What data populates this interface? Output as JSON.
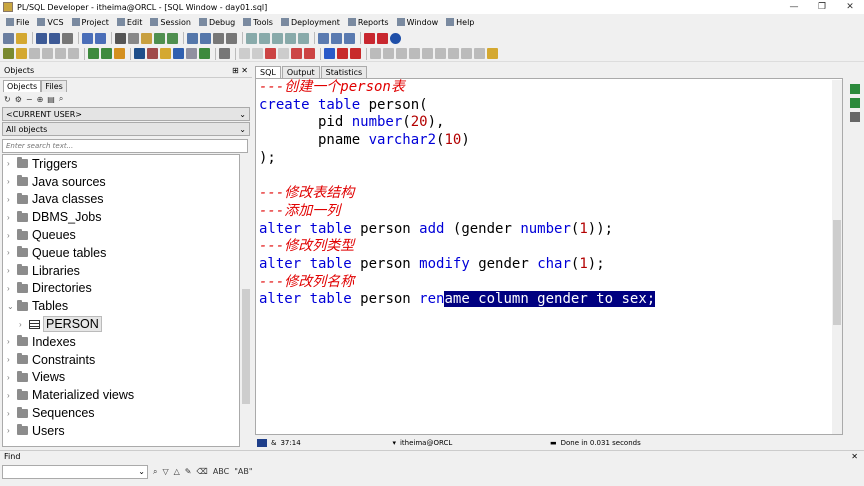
{
  "window": {
    "title": "PL/SQL Developer - itheima@ORCL - [SQL Window - day01.sql]",
    "controls": [
      "—",
      "❐",
      "✕"
    ]
  },
  "menu": [
    "File",
    "VCS",
    "Project",
    "Edit",
    "Session",
    "Debug",
    "Tools",
    "Deployment",
    "Reports",
    "Window",
    "Help"
  ],
  "left_pane": {
    "title": "Objects",
    "tabs": [
      "Objects",
      "Files"
    ],
    "user_combo": "<CURRENT USER>",
    "filter_combo": "All objects",
    "search_placeholder": "Enter search text...",
    "tree": [
      {
        "label": "Triggers",
        "expanded": false
      },
      {
        "label": "Java sources",
        "expanded": false
      },
      {
        "label": "Java classes",
        "expanded": false
      },
      {
        "label": "DBMS_Jobs",
        "expanded": false
      },
      {
        "label": "Queues",
        "expanded": false
      },
      {
        "label": "Queue tables",
        "expanded": false
      },
      {
        "label": "Libraries",
        "expanded": false
      },
      {
        "label": "Directories",
        "expanded": false
      },
      {
        "label": "Tables",
        "expanded": true
      },
      {
        "label": "PERSON",
        "child": true
      },
      {
        "label": "Indexes",
        "expanded": false
      },
      {
        "label": "Constraints",
        "expanded": false
      },
      {
        "label": "Views",
        "expanded": false
      },
      {
        "label": "Materialized views",
        "expanded": false
      },
      {
        "label": "Sequences",
        "expanded": false
      },
      {
        "label": "Users",
        "expanded": false
      }
    ]
  },
  "editor": {
    "tabs": [
      "SQL",
      "Output",
      "Statistics"
    ],
    "lines": [
      "---创建一个person表",
      "create table person(",
      "       pid number(20),",
      "       pname varchar2(10)",
      ");",
      "",
      "---修改表结构",
      "---添加一列",
      "alter table person add (gender number(1));",
      "---修改列类型",
      "alter table person modify gender char(1);",
      "---修改列名称",
      "alter table person rename column gender to sex;"
    ]
  },
  "status": {
    "position": "37:14",
    "connection": "itheima@ORCL",
    "message": "Done in 0.031 seconds"
  },
  "find": {
    "label": "Find",
    "value": "",
    "buttons": [
      "ABC",
      "\"AB\""
    ]
  },
  "colors": {
    "comment": "#e00000",
    "keyword": "#0000d8",
    "selection": "#000080"
  }
}
